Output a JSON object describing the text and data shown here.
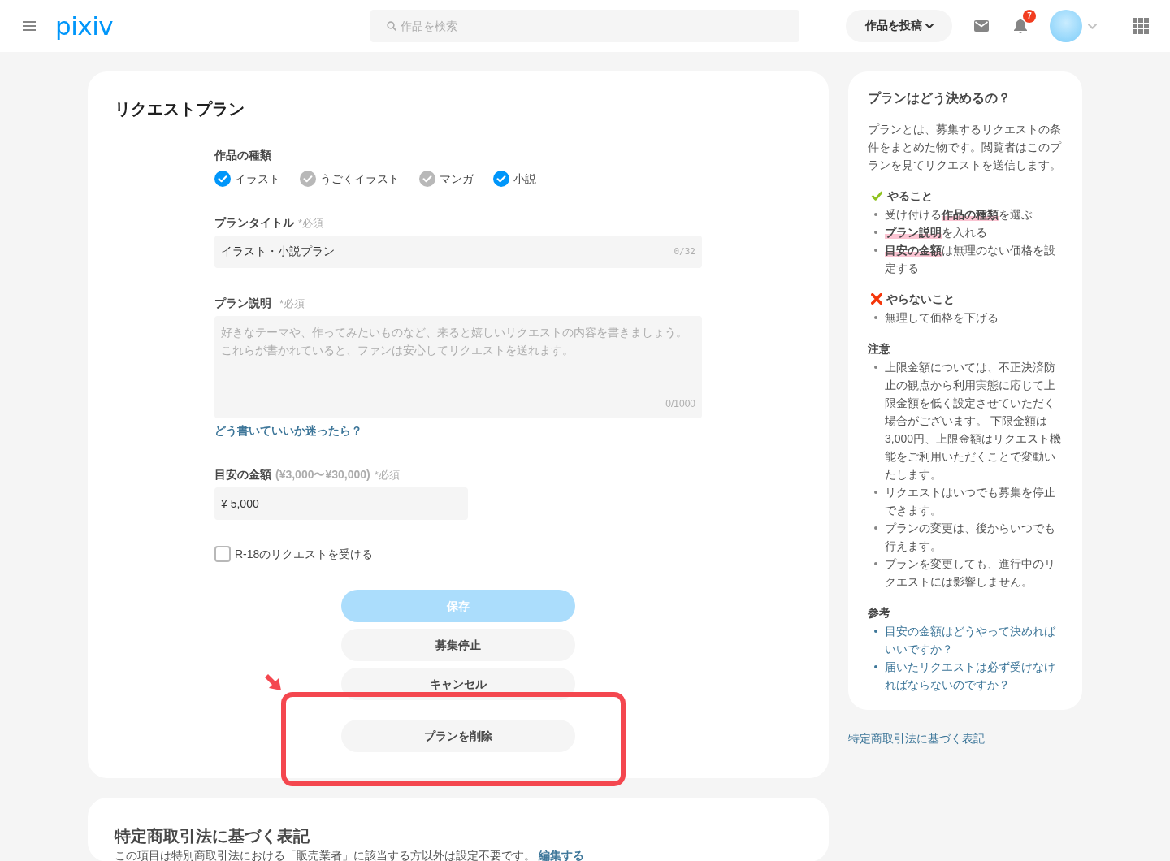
{
  "header": {
    "logo": "pixiv",
    "search": {
      "placeholder": "作品を検索"
    },
    "post_button": "作品を投稿",
    "notification_count": "7"
  },
  "plan_form": {
    "title": "リクエストプラン",
    "work_types": {
      "label": "作品の種類",
      "options": [
        {
          "label": "イラスト",
          "checked": true
        },
        {
          "label": "うごくイラスト",
          "checked": false
        },
        {
          "label": "マンガ",
          "checked": false
        },
        {
          "label": "小説",
          "checked": true
        }
      ]
    },
    "plan_title": {
      "label": "プランタイトル",
      "required": "*必須",
      "value": "イラスト・小説プラン",
      "counter": "0/32"
    },
    "plan_description": {
      "label": "プラン説明",
      "required": "*必須",
      "placeholder": "好きなテーマや、作ってみたいものなど、来ると嬉しいリクエストの内容を書きましょう。これらが書かれていると、ファンは安心してリクエストを送れます。",
      "counter": "0/1000",
      "help_link": "どう書いていいか迷ったら？"
    },
    "price": {
      "label": "目安の金額",
      "range": "(¥3,000〜¥30,000)",
      "required": "*必須",
      "value": "¥ 5,000"
    },
    "r18": {
      "label": "R-18のリクエストを受ける",
      "checked": false
    },
    "buttons": [
      {
        "label": "保存",
        "kind": "primary",
        "disabled": true,
        "highlighted": false
      },
      {
        "label": "募集停止",
        "kind": "secondary",
        "disabled": false,
        "highlighted": false
      },
      {
        "label": "キャンセル",
        "kind": "secondary",
        "disabled": false,
        "highlighted": false
      },
      {
        "label": "プランを削除",
        "kind": "destructive",
        "disabled": false,
        "highlighted": true
      }
    ]
  },
  "legal_notice": {
    "title": "特定商取引法に基づく表記",
    "text": "この項目は特別商取引法における「販売業者」に該当する方以外は設定不要です。",
    "edit_link": "編集する"
  },
  "guide": {
    "title": "プランはどう決めるの？",
    "intro": "プランとは、募集するリクエストの条件をまとめた物です。閲覧者はこのプランを見てリクエストを送信します。",
    "sections": [
      {
        "kind": "do",
        "heading": "やること",
        "items": [
          "受け付ける**作品の種類**を選ぶ",
          "**プラン説明**を入れる",
          "**目安の金額**は無理のない価格を設定する"
        ]
      },
      {
        "kind": "dont",
        "heading": "やらないこと",
        "items": [
          "無理して価格を下げる"
        ]
      },
      {
        "kind": "note",
        "heading": "注意",
        "items": [
          "上限金額については、不正決済防止の観点から利用実態に応じて上限金額を低く設定させていただく場合がございます。 下限金額は3,000円、上限金額はリクエスト機能をご利用いただくことで変動いたします。",
          "リクエストはいつでも募集を停止できます。",
          "プランの変更は、後からいつでも行えます。",
          "プランを変更しても、進行中のリクエストには影響しません。"
        ]
      },
      {
        "kind": "links",
        "heading": "参考",
        "items": [
          "目安の金額はどうやって決めればいいですか？",
          "届いたリクエストは必ず受けなければならないのですか？"
        ]
      }
    ]
  },
  "side_footer_link": "特定商取引法に基づく表記"
}
